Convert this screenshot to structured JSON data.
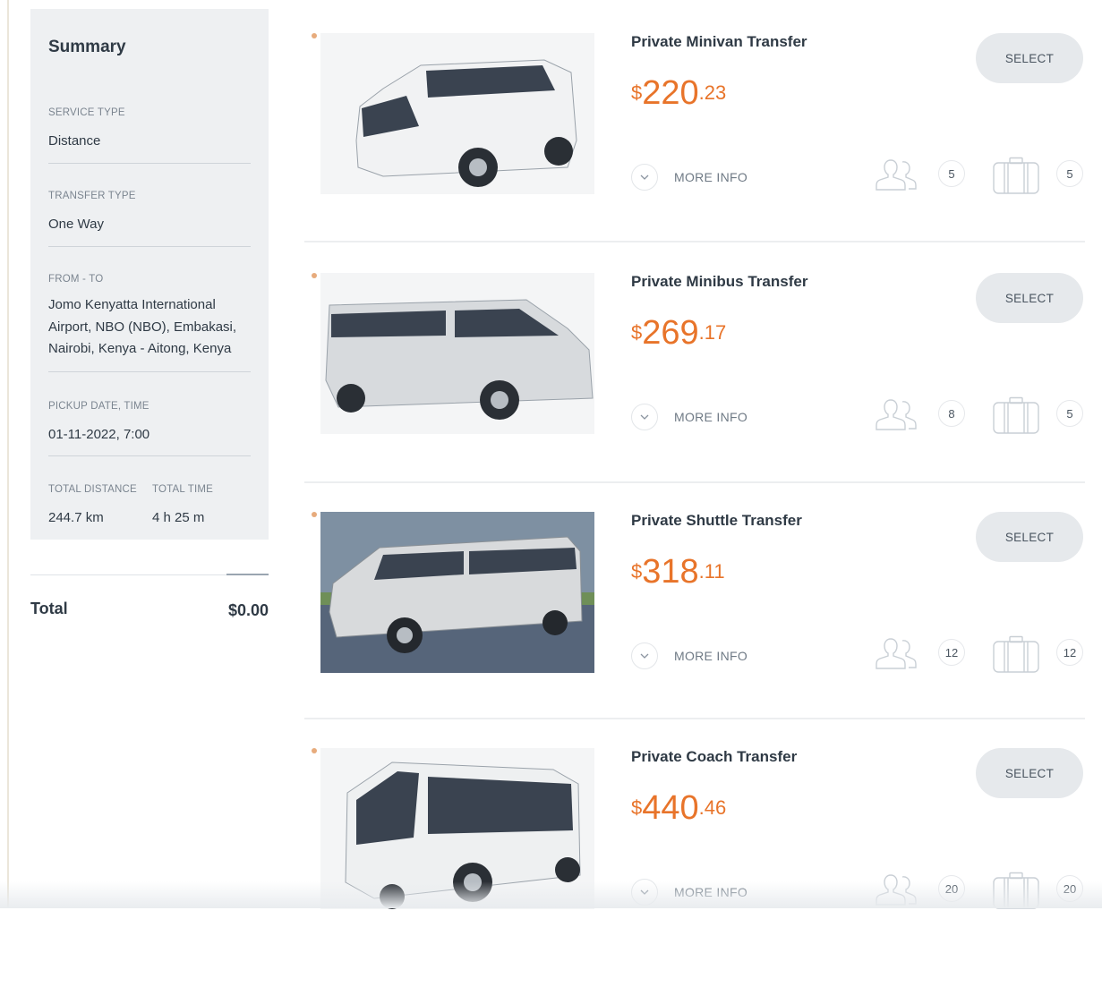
{
  "summary": {
    "title": "Summary",
    "service_type": {
      "label": "SERVICE TYPE",
      "value": "Distance"
    },
    "transfer_type": {
      "label": "TRANSFER TYPE",
      "value": "One Way"
    },
    "from_to": {
      "label": "FROM - TO",
      "value": "Jomo Kenyatta International Airport, NBO (NBO), Embakasi, Nairobi, Kenya - Aitong, Kenya"
    },
    "pickup": {
      "label": "PICKUP DATE, TIME",
      "value": "01-11-2022, 7:00"
    },
    "total_distance": {
      "label": "TOTAL DISTANCE",
      "value": "244.7 km"
    },
    "total_time": {
      "label": "TOTAL TIME",
      "value": "4 h 25 m"
    }
  },
  "total": {
    "label": "Total",
    "value": "$0.00"
  },
  "vehicles": [
    {
      "title": "Private Minivan Transfer",
      "currency": "$",
      "price_int": "220",
      "price_dec": ".23",
      "more_info": "MORE INFO",
      "select": "SELECT",
      "passengers": "5",
      "luggage": "5",
      "image_type": "minivan"
    },
    {
      "title": "Private Minibus Transfer",
      "currency": "$",
      "price_int": "269",
      "price_dec": ".17",
      "more_info": "MORE INFO",
      "select": "SELECT",
      "passengers": "8",
      "luggage": "5",
      "image_type": "minibus"
    },
    {
      "title": "Private Shuttle Transfer",
      "currency": "$",
      "price_int": "318",
      "price_dec": ".11",
      "more_info": "MORE INFO",
      "select": "SELECT",
      "passengers": "12",
      "luggage": "12",
      "image_type": "shuttle"
    },
    {
      "title": "Private Coach Transfer",
      "currency": "$",
      "price_int": "440",
      "price_dec": ".46",
      "more_info": "MORE INFO",
      "select": "SELECT",
      "passengers": "20",
      "luggage": "20",
      "image_type": "coach"
    }
  ],
  "colors": {
    "accent": "#e8742a",
    "panel": "#eef0f2",
    "button": "#e6e9ec"
  },
  "icons": {
    "passengers": "people-icon",
    "luggage": "suitcase-icon",
    "more": "chevron-down-icon"
  }
}
